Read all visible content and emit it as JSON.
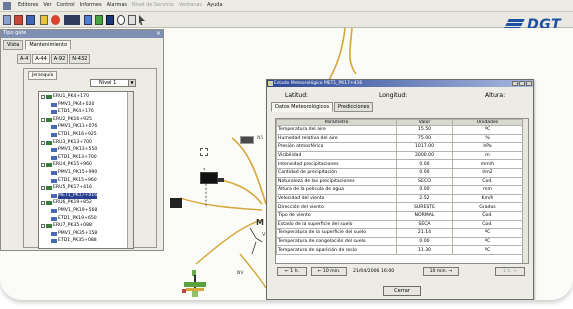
{
  "menubar": {
    "items": [
      "Editores",
      "Ver",
      "Control",
      "Informes",
      "Alarmas",
      "Nivel de Servicio",
      "Ventanas",
      "Ayuda"
    ],
    "dim_items": [
      5,
      6
    ]
  },
  "logo": {
    "text": "DGT"
  },
  "map": {
    "labels": [
      "M",
      "V",
      "N5",
      "NV"
    ]
  },
  "left_panel": {
    "title": "Tipo gate",
    "tabs": [
      "Vista",
      "Mantenimiento"
    ],
    "route_tabs": [
      "A-4",
      "A-44",
      "A-92",
      "N-432"
    ],
    "active_route_tab": 1,
    "subtab": "Jeranquía",
    "level_select": {
      "value": "Nivel 1"
    },
    "tree": [
      {
        "label": "ERU1_PK4+170",
        "indent": 0
      },
      {
        "label": "PMV1_PK4+020",
        "indent": 1
      },
      {
        "label": "ETD1_PK4+176",
        "indent": 1
      },
      {
        "label": "ERU2_PK16+925",
        "indent": 0
      },
      {
        "label": "PMV1_PK11+076",
        "indent": 1
      },
      {
        "label": "ETD1_PK16+925",
        "indent": 1
      },
      {
        "label": "ERU3_PK13+700",
        "indent": 0
      },
      {
        "label": "PMV1_PK13+550",
        "indent": 1
      },
      {
        "label": "ETD1_PK13+700",
        "indent": 1
      },
      {
        "label": "ERU4_PK15+960",
        "indent": 0
      },
      {
        "label": "PMV1_PK15+990",
        "indent": 1
      },
      {
        "label": "ETD1_PK15+960",
        "indent": 1
      },
      {
        "label": "ERU5_PK17+416",
        "indent": 0
      },
      {
        "label": "MET1_PK17+416",
        "indent": 1,
        "selected": true
      },
      {
        "label": "ERU6_PK19+852",
        "indent": 0
      },
      {
        "label": "PMV1_PK19+568",
        "indent": 1
      },
      {
        "label": "ETD1_PK19+650",
        "indent": 1
      },
      {
        "label": "ERU7_PK35+088",
        "indent": 0
      },
      {
        "label": "PMV1_PK35+158",
        "indent": 1
      },
      {
        "label": "ETD1_PK35+088",
        "indent": 1
      }
    ]
  },
  "dialog": {
    "title": "Estado Meteorológico MET1_PK17+416",
    "header": {
      "latitud": "Latitud:",
      "longitud": "Longitud:",
      "altura": "Altura:"
    },
    "tabs": [
      "Datos Meteorológicos",
      "Predicciones"
    ],
    "columns": [
      "Parámetro",
      "Valor",
      "Unidades"
    ],
    "rows": [
      [
        "Temperatura del aire",
        "15.50",
        "ºC"
      ],
      [
        "Humedad relativa del aire",
        "75.00",
        "%"
      ],
      [
        "Presión atmosférica",
        "1017.00",
        "hPa"
      ],
      [
        "Visibilidad",
        "2000.00",
        "m"
      ],
      [
        "Intensidad precipitaciones",
        "0.00",
        "mm/h"
      ],
      [
        "Cantidad de precipitación",
        "0.00",
        "l/m2"
      ],
      [
        "Naturaleza de las precipitaciones",
        "SECO",
        "Cod."
      ],
      [
        "Altura de la película de agua",
        "0.00",
        "mm"
      ],
      [
        "Velocidad del viento",
        "2.52",
        "Km/h"
      ],
      [
        "Dirección del viento",
        "SURESTE",
        "Grados"
      ],
      [
        "Tipo de viento",
        "NORMAL",
        "Cod."
      ],
      [
        "Estado de la superficie del suelo",
        "SECA",
        "Cod."
      ],
      [
        "Temperatura de la superficie del suelo",
        "21.14",
        "ºC"
      ],
      [
        "Temperatura de congelación del suelo",
        "0.00",
        "ºC"
      ],
      [
        "Temperatura de aparición de rocío",
        "11.30",
        "ºC"
      ]
    ],
    "nav": {
      "back_1h": "← 1 h.",
      "back_10": "← 10 min.",
      "date": "21/04/2006 16:00",
      "fwd_10": "10 min. →",
      "fwd_1h": "1 h. →"
    },
    "close": "Cerrar"
  }
}
